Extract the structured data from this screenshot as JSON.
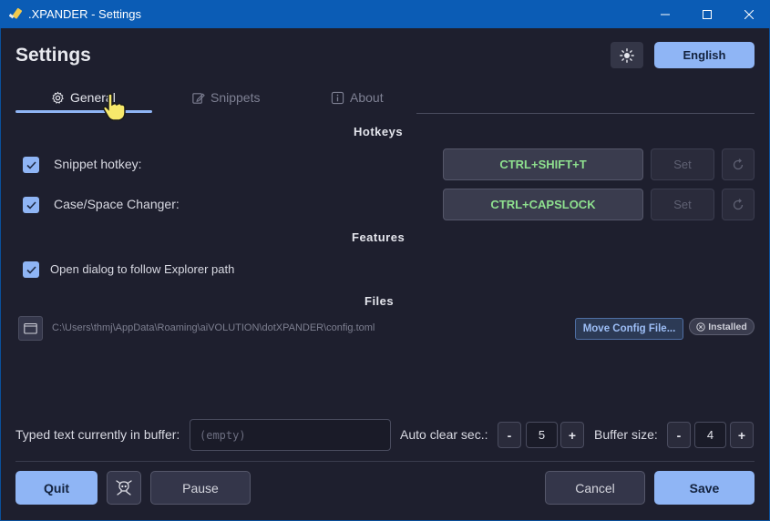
{
  "window": {
    "title": ".XPANDER - Settings",
    "colors": {
      "titlebar": "#0b5cb5",
      "background": "#1e1f2e",
      "accent": "#8fb5f5",
      "hotkey_text": "#8ee08e"
    }
  },
  "header": {
    "title": "Settings",
    "theme_icon": "sun-icon",
    "language_label": "English"
  },
  "tabs": [
    {
      "label": "General",
      "icon": "gear-icon",
      "active": true
    },
    {
      "label": "Snippets",
      "icon": "edit-icon",
      "active": false
    },
    {
      "label": "About",
      "icon": "info-icon",
      "active": false
    }
  ],
  "hotkeys": {
    "heading": "Hotkeys",
    "rows": [
      {
        "label": "Snippet hotkey:",
        "value": "CTRL+SHIFT+T",
        "set_label": "Set",
        "checked": true
      },
      {
        "label": "Case/Space Changer:",
        "value": "CTRL+CAPSLOCK",
        "set_label": "Set",
        "checked": true
      }
    ]
  },
  "features": {
    "heading": "Features",
    "items": [
      {
        "label": "Open dialog to follow Explorer path",
        "checked": true
      }
    ]
  },
  "files": {
    "heading": "Files",
    "config_path": "C:\\Users\\thmj\\AppData\\Roaming\\aiVOLUTION\\dotXPANDER\\config.toml",
    "move_label": "Move Config File...",
    "installed_label": "Installed"
  },
  "buffer": {
    "label": "Typed text currently in buffer:",
    "placeholder": "(empty)",
    "auto_clear_label": "Auto clear sec.:",
    "auto_clear_value": "5",
    "buffer_size_label": "Buffer size:",
    "buffer_size_value": "4",
    "minus": "-",
    "plus": "+"
  },
  "footer": {
    "quit_label": "Quit",
    "pause_label": "Pause",
    "cancel_label": "Cancel",
    "save_label": "Save"
  }
}
